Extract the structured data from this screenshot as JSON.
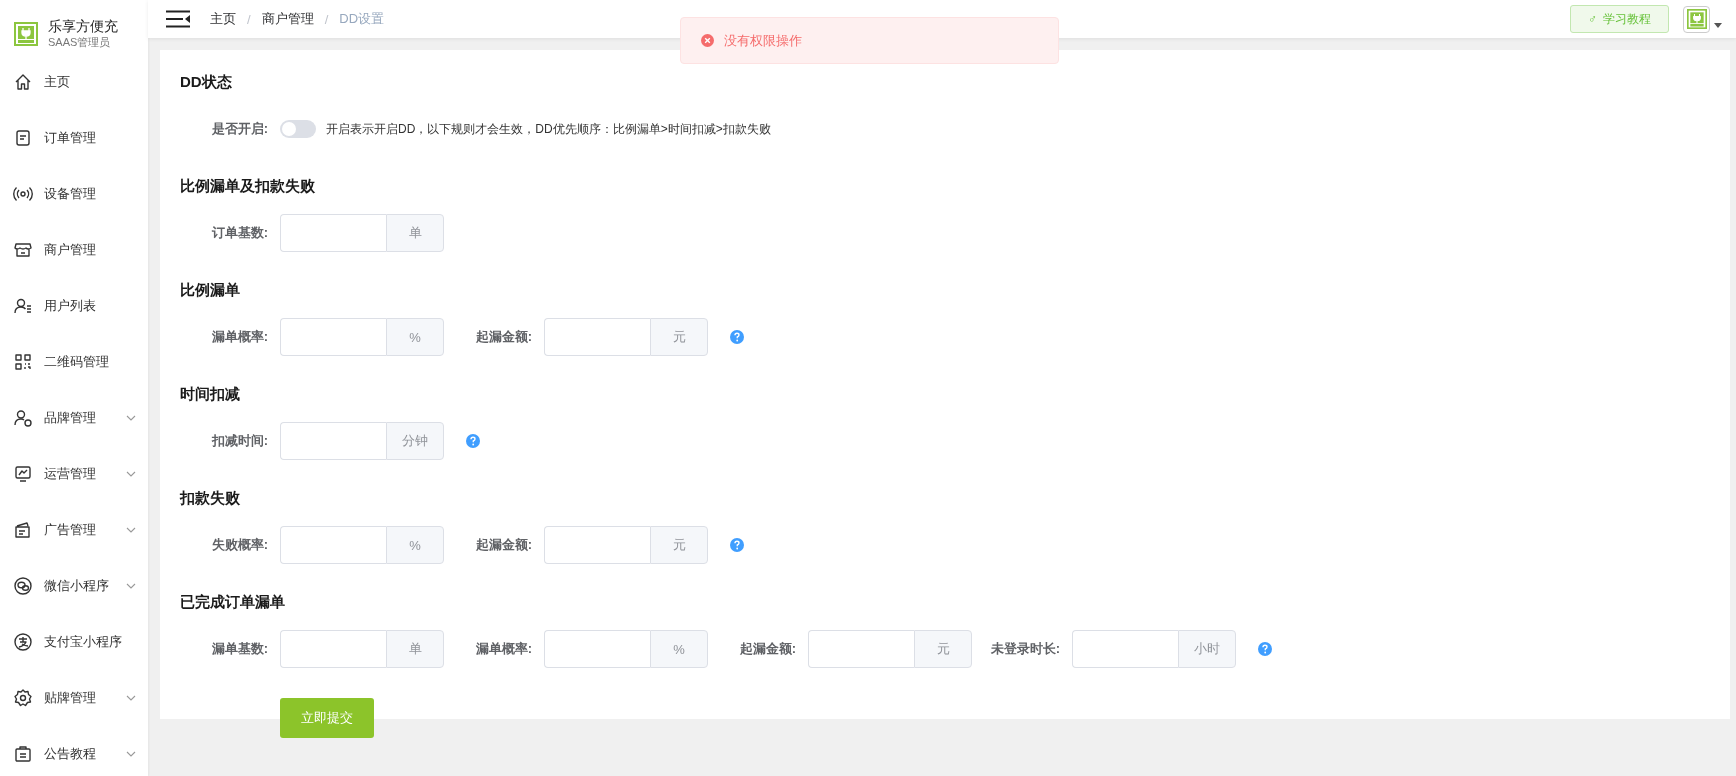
{
  "sidebar": {
    "brand": {
      "name": "乐享方便充",
      "subtitle": "SAAS管理员"
    },
    "items": [
      {
        "label": "主页",
        "has_submenu": false
      },
      {
        "label": "订单管理",
        "has_submenu": false
      },
      {
        "label": "设备管理",
        "has_submenu": false
      },
      {
        "label": "商户管理",
        "has_submenu": false
      },
      {
        "label": "用户列表",
        "has_submenu": false
      },
      {
        "label": "二维码管理",
        "has_submenu": false
      },
      {
        "label": "品牌管理",
        "has_submenu": true
      },
      {
        "label": "运营管理",
        "has_submenu": true
      },
      {
        "label": "广告管理",
        "has_submenu": true
      },
      {
        "label": "微信小程序",
        "has_submenu": true
      },
      {
        "label": "支付宝小程序",
        "has_submenu": false
      },
      {
        "label": "贴牌管理",
        "has_submenu": true
      },
      {
        "label": "公告教程",
        "has_submenu": true
      }
    ]
  },
  "header": {
    "breadcrumb": [
      {
        "label": "主页",
        "current": false
      },
      {
        "label": "商户管理",
        "current": false
      },
      {
        "label": "DD设置",
        "current": true
      }
    ],
    "separator": "/",
    "tutorial_button": {
      "icon": "♂",
      "label": "学习教程"
    }
  },
  "toast": {
    "kind": "error",
    "message": "没有权限操作"
  },
  "form": {
    "sections": [
      {
        "title": "DD状态",
        "rows": [
          {
            "kind": "switch",
            "label": "是否开启:",
            "on": false,
            "description": "开启表示开启DD，以下规则才会生效，DD优先顺序：比例漏单>时间扣减>扣款失败"
          }
        ]
      },
      {
        "title": "比例漏单及扣款失败",
        "rows": [
          {
            "kind": "inputs",
            "help": false,
            "fields": [
              {
                "label": "订单基数:",
                "unit": "单"
              }
            ]
          }
        ]
      },
      {
        "title": "比例漏单",
        "rows": [
          {
            "kind": "inputs",
            "help": true,
            "fields": [
              {
                "label": "漏单概率:",
                "unit": "%"
              },
              {
                "label": "起漏金额:",
                "unit": "元"
              }
            ]
          }
        ]
      },
      {
        "title": "时间扣减",
        "rows": [
          {
            "kind": "inputs",
            "help": true,
            "fields": [
              {
                "label": "扣减时间:",
                "unit": "分钟"
              }
            ]
          }
        ]
      },
      {
        "title": "扣款失败",
        "rows": [
          {
            "kind": "inputs",
            "help": true,
            "fields": [
              {
                "label": "失败概率:",
                "unit": "%"
              },
              {
                "label": "起漏金额:",
                "unit": "元"
              }
            ]
          }
        ]
      },
      {
        "title": "已完成订单漏单",
        "rows": [
          {
            "kind": "inputs",
            "help": true,
            "fields": [
              {
                "label": "漏单基数:",
                "unit": "单"
              },
              {
                "label": "漏单概率:",
                "unit": "%"
              },
              {
                "label": "起漏金额:",
                "unit": "元"
              },
              {
                "label": "未登录时长:",
                "unit": "小时"
              }
            ]
          }
        ]
      }
    ],
    "submit": "立即提交"
  }
}
